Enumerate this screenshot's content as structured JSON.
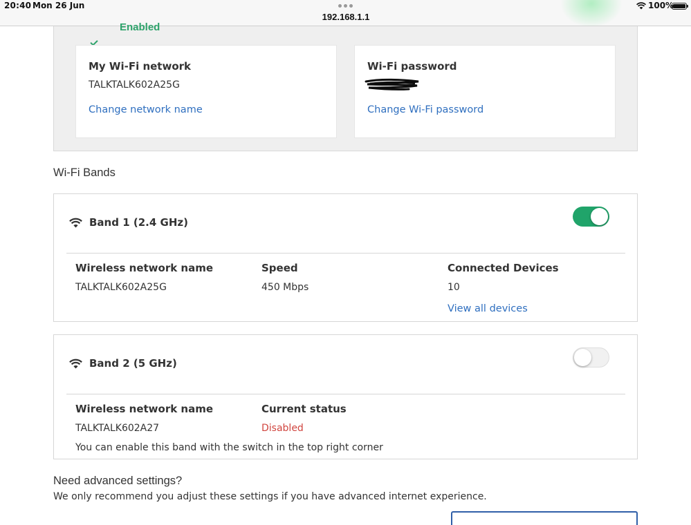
{
  "status_bar": {
    "time": "20:40",
    "date": "Mon 26 Jun",
    "url": "192.168.1.1",
    "battery": "100%"
  },
  "top_panel": {
    "status": "Enabled",
    "network_card": {
      "title": "My Wi-Fi network",
      "value": "TALKTALK602A25G",
      "link": "Change network name"
    },
    "password_card": {
      "title": "Wi-Fi password",
      "link": "Change Wi-Fi password"
    }
  },
  "bands_section": {
    "title": "Wi-Fi Bands",
    "band1": {
      "name": "Band 1 (2.4 GHz)",
      "enabled": true,
      "col1_head": "Wireless network name",
      "col1_val": "TALKTALK602A25G",
      "col2_head": "Speed",
      "col2_val": "450 Mbps",
      "col3_head": "Connected Devices",
      "col3_val": "10",
      "col3_link": "View all devices"
    },
    "band2": {
      "name": "Band 2 (5 GHz)",
      "enabled": false,
      "col1_head": "Wireless network name",
      "col1_val": "TALKTALK602A27",
      "col2_head": "Current status",
      "col2_val": "Disabled",
      "hint": "You can enable this band with the switch in the top right corner"
    }
  },
  "advanced": {
    "title": "Need advanced settings?",
    "description": "We only recommend you adjust these settings if you have advanced internet experience."
  },
  "colors": {
    "accent_green": "#20a46a",
    "link_blue": "#2f6fbf",
    "disabled_red": "#d0453f"
  }
}
